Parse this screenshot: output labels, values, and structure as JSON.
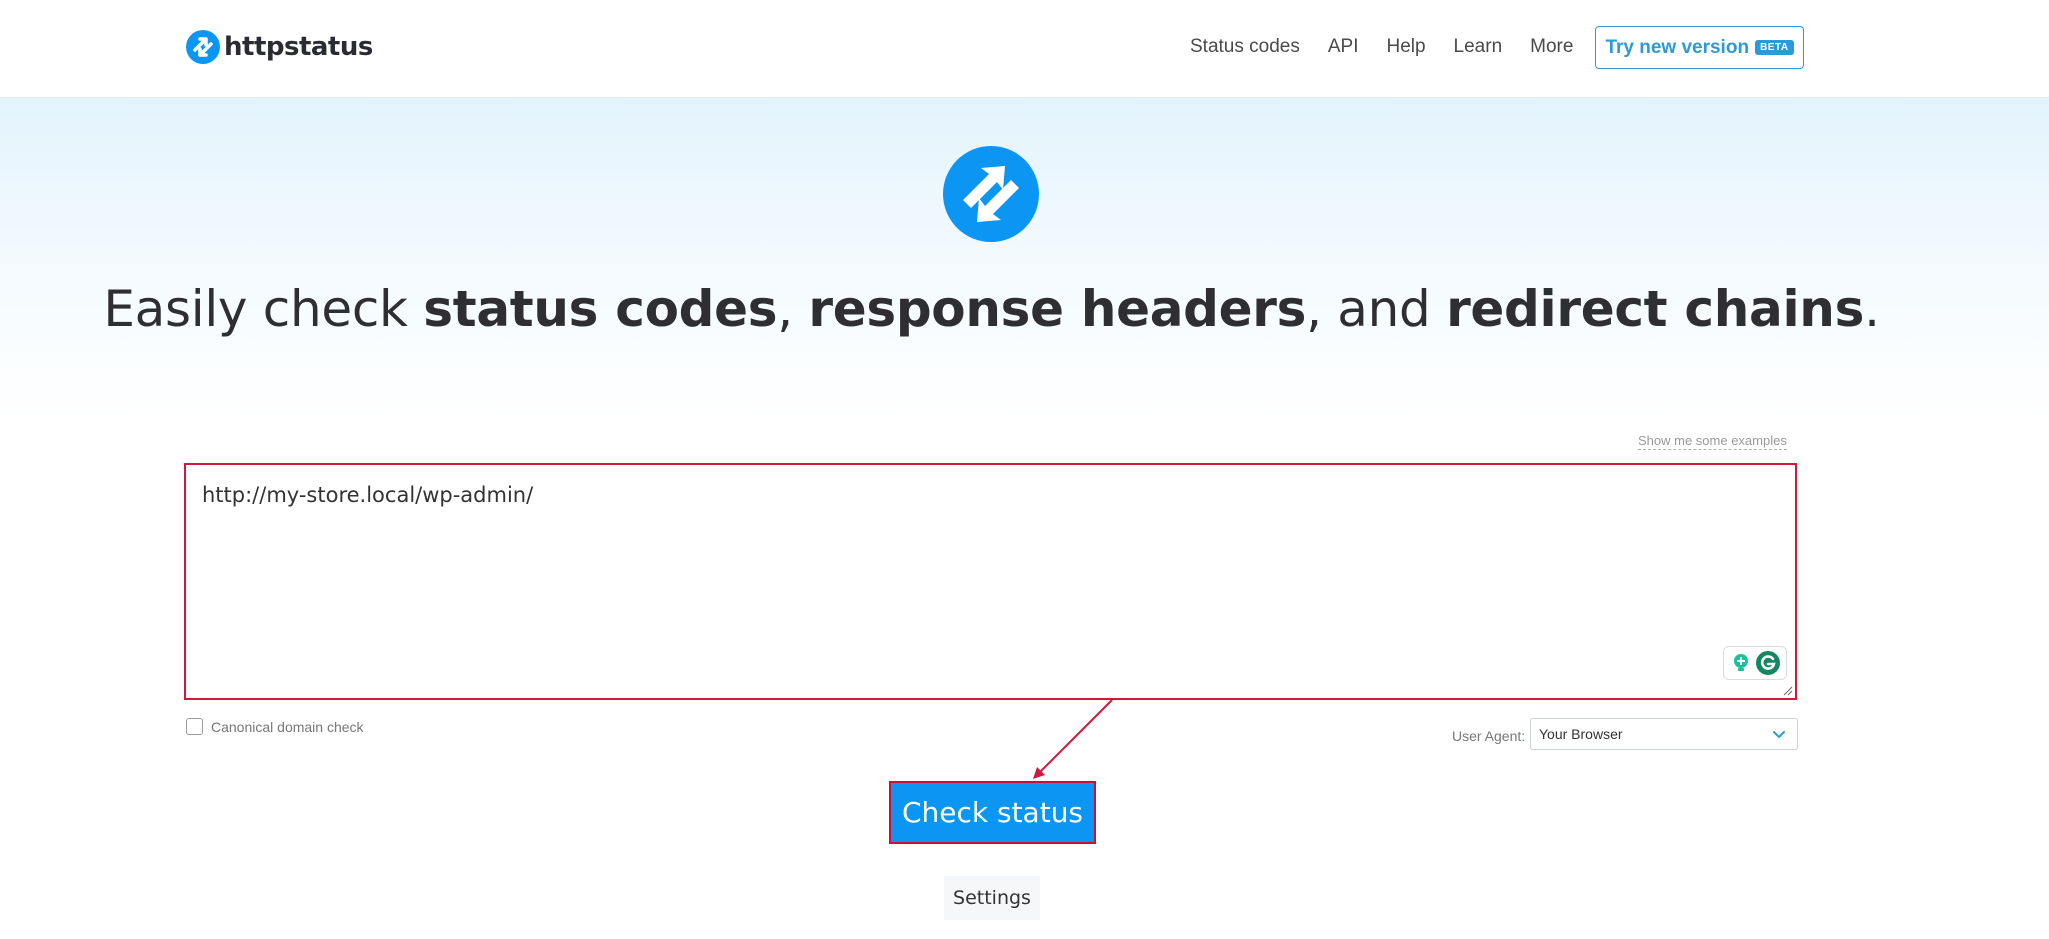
{
  "header": {
    "logo_text": "httpstatus",
    "nav": [
      "Status codes",
      "API",
      "Help",
      "Learn",
      "More"
    ],
    "try_button": "Try new version",
    "beta_badge": "BETA"
  },
  "hero": {
    "headline_parts": {
      "p1": "Easily check ",
      "b1": "status codes",
      "p2": ", ",
      "b2": "response headers",
      "p3": ", and ",
      "b3": "redirect chains",
      "p4": "."
    }
  },
  "form": {
    "examples_link": "Show me some examples",
    "url_value": "http://my-store.local/wp-admin/",
    "canonical_label": "Canonical domain check",
    "canonical_checked": false,
    "user_agent_label": "User Agent:",
    "user_agent_value": "Your Browser",
    "check_button": "Check status",
    "settings_button": "Settings"
  },
  "colors": {
    "brand_blue": "#0a96f2",
    "accent_blue": "#2d9ad8",
    "annotation_red": "#d01a3a"
  }
}
